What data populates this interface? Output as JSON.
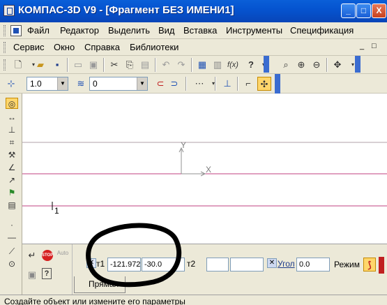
{
  "window": {
    "title": "КОМПАС-3D V9 - [Фрагмент БЕЗ ИМЕНИ1]",
    "minimize": "_",
    "maximize": "□",
    "close": "X"
  },
  "menu": {
    "row1": [
      "Файл",
      "Редактор",
      "Выделить",
      "Вид",
      "Вставка",
      "Инструменты",
      "Спецификация"
    ],
    "row2": [
      "Сервис",
      "Окно",
      "Справка",
      "Библиотеки"
    ],
    "mdi_minimize": "_",
    "mdi_restore": "□"
  },
  "toolbar2": {
    "line_style_value": "1.0",
    "layer_value": "0"
  },
  "icons": {
    "new": "new-document-icon",
    "open": "open-folder-icon",
    "save": "save-icon",
    "fx": "f(x)",
    "help": "?"
  },
  "canvas": {
    "axis_y_label": "Y",
    "axis_x_label": "X",
    "cursor_label": "1",
    "colors": {
      "hline_gray": "#b0a0a8",
      "hline_pink": "#c04080",
      "axis": "#909090",
      "overlay_stroke": "#000000"
    }
  },
  "propbar": {
    "point1_label": "т1",
    "point1_x": "-121.972",
    "point1_y": "-30.0",
    "point2_label": "т2",
    "point2_x": "",
    "point2_y": "",
    "angle_label": "Угол",
    "angle_value": "0.0",
    "mode_label": "Режим",
    "auto_label": "Auto",
    "stop_label": "STOP",
    "tab_label": "Прямая"
  },
  "status": {
    "message": "Создайте объект или измените его параметры"
  }
}
